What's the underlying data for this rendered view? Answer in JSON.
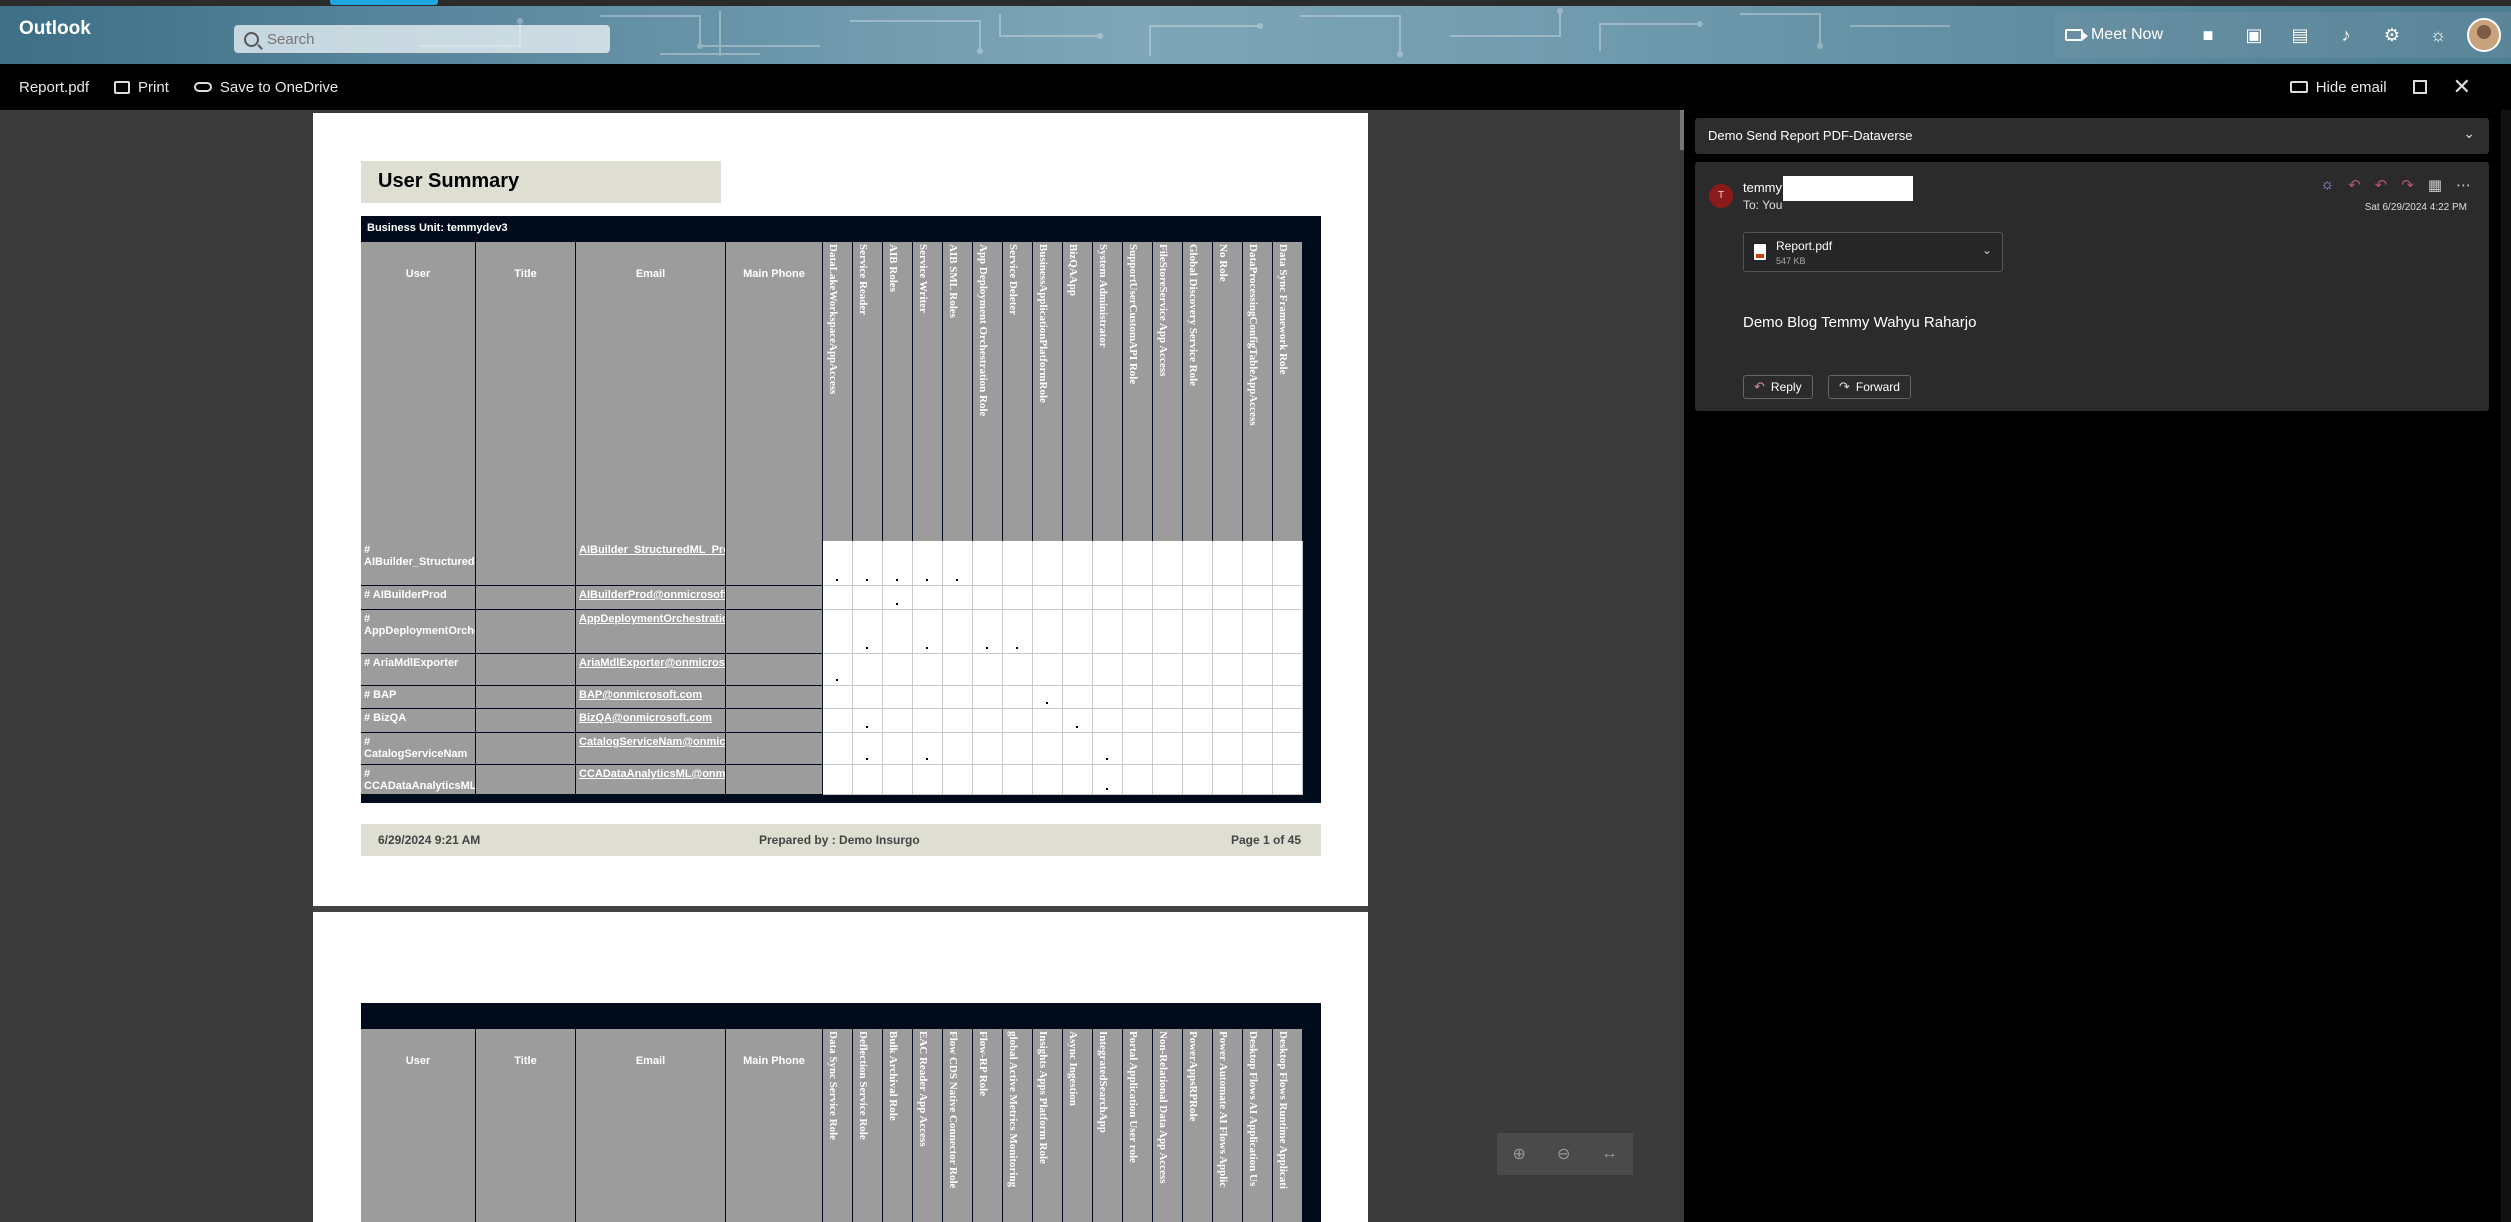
{
  "os": {},
  "header": {
    "app_name": "Outlook",
    "search_placeholder": "Search",
    "meet_now": "Meet Now"
  },
  "toolbar": {
    "file_name": "Report.pdf",
    "print": "Print",
    "save_onedrive": "Save to OneDrive",
    "hide_email": "Hide email"
  },
  "report": {
    "title": "User Summary",
    "business_unit": "Business Unit: temmydev3",
    "fixed_headers": [
      "User",
      "Title",
      "Email",
      "Main Phone"
    ],
    "role_headers": [
      "DataLakeWorkspaceAppAccess",
      "Service Reader",
      "AIB Roles",
      "Service Writer",
      "AIB SML Roles",
      "App Deployment Orchestration Role",
      "Service Deleter",
      "BusinessApplicationPlatformRole",
      "BizQAApp",
      "System Administrator",
      "SupportUserCustomAPI Role",
      "FileStoreService App Access",
      "Global Discovery Service Role",
      "No Role",
      "DataProcessingConfigTableAppAccess",
      "Data Sync Framework Role"
    ],
    "rows": [
      {
        "user": "# AIBuilder_StructuredML_Prod_CDS",
        "title": "",
        "email": "AIBuilder_StructuredML_Prod_CDS@onmicrosoft.com",
        "phone": "",
        "checks": [
          0,
          1,
          2,
          3,
          4
        ]
      },
      {
        "user": "# AIBuilderProd",
        "title": "",
        "email": "AIBuilderProd@onmicrosoft.com",
        "phone": "",
        "checks": [
          2
        ]
      },
      {
        "user": "# AppDeploymentOrchestration",
        "title": "",
        "email": "AppDeploymentOrchestration@onmicrosoft.com",
        "phone": "",
        "checks": [
          1,
          3,
          5,
          6
        ]
      },
      {
        "user": "# AriaMdlExporter",
        "title": "",
        "email": "AriaMdlExporter@onmicrosoft.com",
        "phone": "",
        "checks": [
          0
        ]
      },
      {
        "user": "# BAP",
        "title": "",
        "email": "BAP@onmicrosoft.com",
        "phone": "",
        "checks": [
          7
        ]
      },
      {
        "user": "# BizQA",
        "title": "",
        "email": "BizQA@onmicrosoft.com",
        "phone": "",
        "checks": [
          1,
          8
        ]
      },
      {
        "user": "# CatalogServiceNam",
        "title": "",
        "email": "CatalogServiceNam@onmicrosoft.com",
        "phone": "",
        "checks": [
          1,
          3,
          9
        ]
      },
      {
        "user": "# CCADataAnalyticsML",
        "title": "",
        "email": "CCADataAnalyticsML@onmicrosoft.com",
        "phone": "",
        "checks": [
          9
        ]
      }
    ],
    "footer_date": "6/29/2024 9:21 AM",
    "footer_prepared": "Prepared by : Demo Insurgo",
    "footer_page": "Page 1 of 45",
    "p2_role_headers": [
      "Data Sync Service Role",
      "Deflection Service Role",
      "Bulk Archival Role",
      "EAC Reader App Access",
      "Flow CDS Native Connector Role",
      "Flow-RP Role",
      "global Active Metrics Monitoring",
      "Insights Apps Platform Role",
      "Async Ingestion",
      "IntegratedSearchApp",
      "Portal Application User role",
      "Non-Relational Data App Access",
      "PowerAppsRPRole",
      "Power Automate AI Flows Applic",
      "Desktop Flows AI Application Us",
      "Desktop Flows Runtime Applicati"
    ]
  },
  "email": {
    "subject": "Demo Send Report PDF-Dataverse",
    "sender_initial": "T",
    "sender": "temmy",
    "to": "To:  You",
    "date": "Sat 6/29/2024 4:22 PM",
    "attachment_name": "Report.pdf",
    "attachment_size": "547 KB",
    "body": "Demo Blog Temmy Wahyu Raharjo",
    "reply": "Reply",
    "forward": "Forward"
  }
}
